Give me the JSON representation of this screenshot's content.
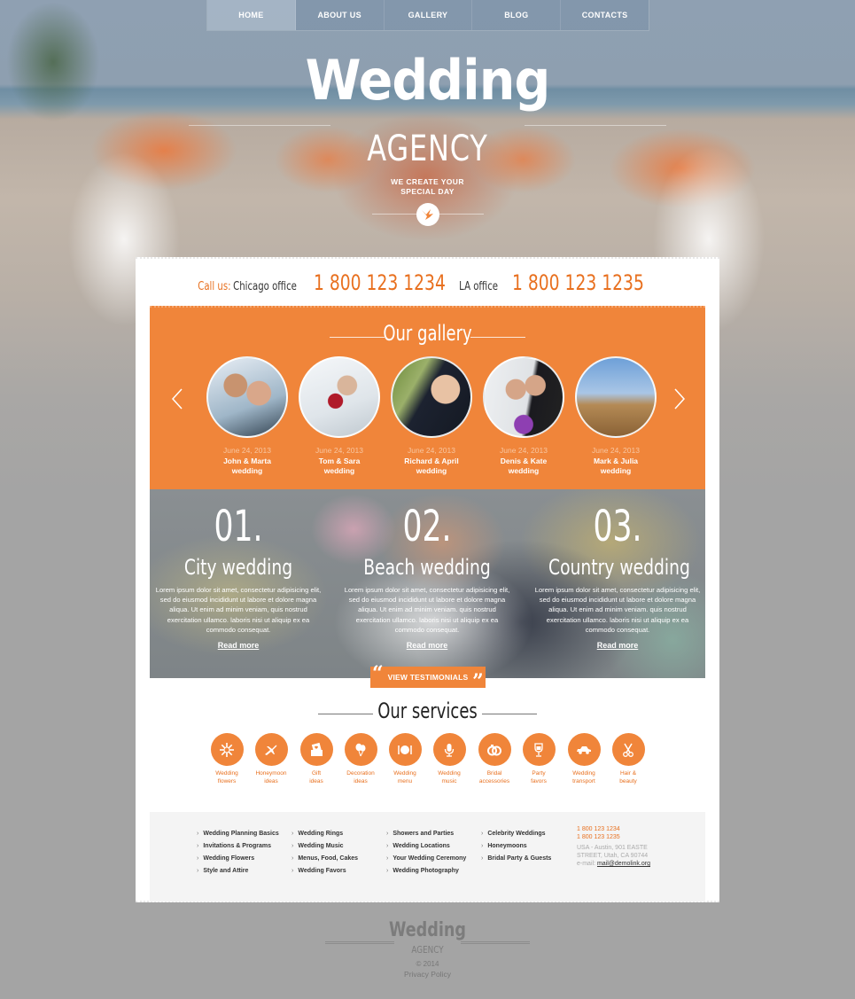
{
  "nav": {
    "items": [
      {
        "label": "HOME",
        "active": true
      },
      {
        "label": "ABOUT US",
        "active": false
      },
      {
        "label": "GALLERY",
        "active": false
      },
      {
        "label": "BLOG",
        "active": false
      },
      {
        "label": "CONTACTS",
        "active": false
      }
    ]
  },
  "logo": {
    "title": "Wedding",
    "subtitle": "AGENCY",
    "tagline_line1": "WE CREATE YOUR",
    "tagline_line2": "SPECIAL DAY",
    "badge_icon": "bird-icon"
  },
  "callus": {
    "label": "Call us:",
    "office1": "Chicago office",
    "phone1": "1 800 123 1234",
    "office2": "LA office",
    "phone2": "1 800 123 1235"
  },
  "gallery": {
    "title": "Our gallery",
    "prev_icon": "chevron-left-icon",
    "next_icon": "chevron-right-icon",
    "items": [
      {
        "date": "June 24, 2013",
        "name": "John & Marta",
        "suffix": "wedding"
      },
      {
        "date": "June 24, 2013",
        "name": "Tom & Sara",
        "suffix": "wedding"
      },
      {
        "date": "June 24, 2013",
        "name": "Richard & April",
        "suffix": "wedding"
      },
      {
        "date": "June 24, 2013",
        "name": "Denis & Kate",
        "suffix": "wedding"
      },
      {
        "date": "June 24, 2013",
        "name": "Mark & Julia",
        "suffix": "wedding"
      }
    ]
  },
  "features": [
    {
      "number": "01.",
      "title": "City wedding",
      "text": "Lorem ipsum dolor sit amet, consectetur adipisicing elit, sed do eiusmod incididunt ut labore et dolore magna aliqua. Ut enim ad minim veniam, quis nostrud exercitation ullamco. laboris nisi ut aliquip ex ea commodo consequat.",
      "link": "Read more"
    },
    {
      "number": "02.",
      "title": "Beach wedding",
      "text": "Lorem ipsum dolor sit amet, consectetur adipisicing elit, sed do eiusmod incididunt ut labore et dolore magna aliqua. Ut enim ad minim veniam. quis nostrud exercitation ullamco. laboris nisi ut aliquip ex ea commodo consequat.",
      "link": "Read more"
    },
    {
      "number": "03.",
      "title": "Country wedding",
      "text": "Lorem ipsum dolor sit amet, consectetur adipisicing elit, sed do eiusmod incididunt ut labore et dolore magna aliqua. Ut enim ad minim veniam. quis nostrud exercitation ullamco. laboris nisi ut aliquip ex ea commodo consequat.",
      "link": "Read more"
    }
  ],
  "testimonials_button": "VIEW TESTIMONIALS",
  "services": {
    "title": "Our services",
    "items": [
      {
        "line1": "Wedding",
        "line2": "flowers",
        "icon": "flower-icon"
      },
      {
        "line1": "Honeymoon",
        "line2": "ideas",
        "icon": "airplane-icon"
      },
      {
        "line1": "Gift",
        "line2": "ideas",
        "icon": "gift-card-icon"
      },
      {
        "line1": "Decoration",
        "line2": "ideas",
        "icon": "balloons-icon"
      },
      {
        "line1": "Wedding",
        "line2": "menu",
        "icon": "plate-cutlery-icon"
      },
      {
        "line1": "Wedding",
        "line2": "music",
        "icon": "microphone-icon"
      },
      {
        "line1": "Bridal",
        "line2": "accessories",
        "icon": "rings-icon"
      },
      {
        "line1": "Party",
        "line2": "favors",
        "icon": "wine-glass-icon"
      },
      {
        "line1": "Wedding",
        "line2": "transport",
        "icon": "car-icon"
      },
      {
        "line1": "Hair &",
        "line2": "beauty",
        "icon": "scissors-icon"
      }
    ]
  },
  "footer_links": {
    "columns": [
      [
        "Wedding Planning Basics",
        "Invitations & Programs",
        "Wedding Flowers",
        "Style and Attire"
      ],
      [
        "Wedding Rings",
        "Wedding Music",
        "Menus, Food, Cakes",
        "Wedding Favors"
      ],
      [
        "Showers and Parties",
        "Wedding Locations",
        "Your Wedding Ceremony",
        "Wedding Photography"
      ],
      [
        "Celebrity Weddings",
        "Honeymoons",
        "Bridal Party & Guests"
      ]
    ]
  },
  "contact": {
    "phone1": "1 800 123 1234",
    "phone2": "1 800 123 1235",
    "address_line1": "USA - Austin, 901 EASTE",
    "address_line2": "STREET, Utah, CA 90744",
    "email_label": "e-mail:",
    "email": "mail@demolink.org"
  },
  "footer": {
    "logo_title": "Wedding",
    "logo_subtitle": "AGENCY",
    "copyright": "© 2014",
    "privacy": "Privacy Policy"
  },
  "colors": {
    "accent": "#f0853a",
    "accent_text": "#e8701f"
  }
}
